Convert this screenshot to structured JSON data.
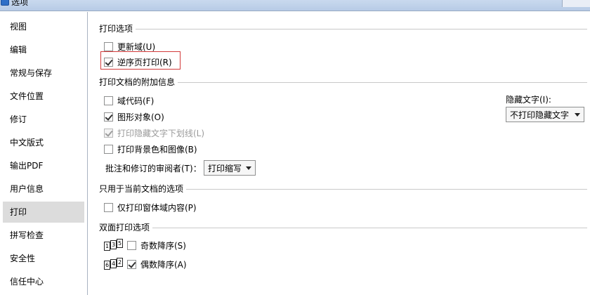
{
  "window": {
    "title": "选项"
  },
  "sidebar": {
    "items": [
      {
        "label": "视图"
      },
      {
        "label": "编辑"
      },
      {
        "label": "常规与保存"
      },
      {
        "label": "文件位置"
      },
      {
        "label": "修订"
      },
      {
        "label": "中文版式"
      },
      {
        "label": "输出PDF"
      },
      {
        "label": "用户信息"
      },
      {
        "label": "打印",
        "selected": true
      },
      {
        "label": "拼写检查"
      },
      {
        "label": "安全性"
      },
      {
        "label": "信任中心"
      }
    ]
  },
  "print_options": {
    "title": "打印选项",
    "update_fields": {
      "label": "更新域(U)",
      "checked": false
    },
    "reverse_order": {
      "label": "逆序页打印(R)",
      "checked": true
    }
  },
  "extra_info": {
    "title": "打印文档的附加信息",
    "field_codes": {
      "label": "域代码(F)",
      "checked": false
    },
    "drawing_objects": {
      "label": "图形对象(O)",
      "checked": true
    },
    "hidden_text_underline": {
      "label": "打印隐藏文字下划线(L)",
      "checked": true,
      "disabled": true
    },
    "background": {
      "label": "打印背景色和图像(B)",
      "checked": false
    },
    "reviewer_label": "批注和修订的审阅者(T)：",
    "reviewer_value": "打印缩写",
    "hidden_text_label": "隐藏文字(I):",
    "hidden_text_value": "不打印隐藏文字"
  },
  "current_doc": {
    "title": "只用于当前文档的选项",
    "form_data_only": {
      "label": "仅打印窗体域内容(P)",
      "checked": false
    }
  },
  "duplex": {
    "title": "双面打印选项",
    "odd_pages": {
      "label": "奇数降序(S)",
      "checked": false,
      "icon_digits": [
        "1",
        "3",
        "5"
      ]
    },
    "even_pages": {
      "label": "偶数降序(A)",
      "checked": true,
      "icon_digits": [
        "6",
        "4",
        "2"
      ]
    }
  },
  "colors": {
    "highlight_border": "#d23a3a",
    "selected_nav": "#dcdcdc"
  }
}
